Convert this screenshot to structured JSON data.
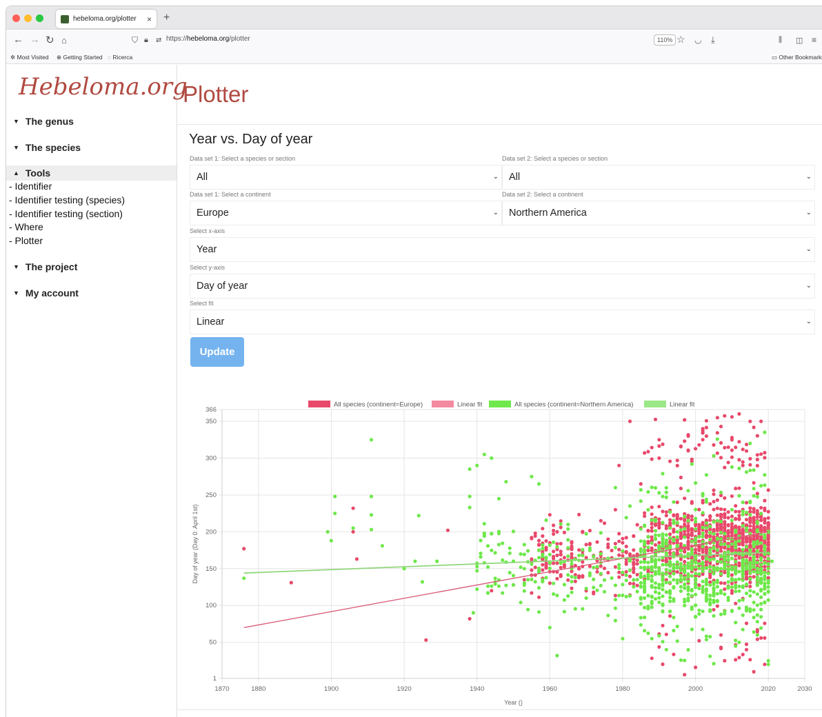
{
  "browser": {
    "tab_title": "hebeloma.org/plotter",
    "url_prefix": "https://",
    "url_host": "hebeloma.org",
    "url_path": "/plotter",
    "zoom": "110%",
    "bookmarks": [
      "Most Visited",
      "Getting Started",
      "Ricerca"
    ],
    "other_bookmarks": "Other Bookmarks"
  },
  "sidebar": {
    "logo": "Hebeloma.org",
    "sections": [
      {
        "label": "The genus"
      },
      {
        "label": "The species"
      },
      {
        "label": "Tools"
      },
      {
        "label": "The project"
      },
      {
        "label": "My account"
      }
    ],
    "tools_items": [
      "- Identifier",
      "- Identifier testing (species)",
      "- Identifier testing (section)",
      "- Where",
      "- Plotter"
    ]
  },
  "main": {
    "page_title": "Plotter",
    "chart_title": "Year vs. Day of year",
    "ds1_species_label": "Data set 1: Select a species or section",
    "ds1_species_value": "All",
    "ds2_species_label": "Data set 2: Select a species or section",
    "ds2_species_value": "All",
    "ds1_continent_label": "Data set 1: Select a continent",
    "ds1_continent_value": "Europe",
    "ds2_continent_label": "Data set 2: Select a continent",
    "ds2_continent_value": "Northern America",
    "xaxis_label": "Select x-axis",
    "xaxis_value": "Year",
    "yaxis_label": "Select y-axis",
    "yaxis_value": "Day of year",
    "fit_label": "Select fit",
    "fit_value": "Linear",
    "update_button": "Update"
  },
  "chart_data": {
    "type": "scatter",
    "xlabel": "Year ()",
    "ylabel": "Day of year (Day 0: April 1st)",
    "xlim": [
      1870,
      2030
    ],
    "ylim": [
      1,
      366
    ],
    "xticks": [
      1870,
      1880,
      1900,
      1920,
      1940,
      1960,
      1980,
      2000,
      2020,
      2030
    ],
    "yticks": [
      1,
      50,
      100,
      150,
      200,
      250,
      300,
      350,
      366
    ],
    "grid": true,
    "legend_position": "top",
    "colors": {
      "europe": "#e8496b",
      "europe_fit": "#f48aa0",
      "na": "#6ee84a",
      "na_fit": "#9be888"
    },
    "legend": [
      "All species (continent=Europe)",
      "Linear fit",
      "All species (continent=Northern America)",
      "Linear fit"
    ],
    "series": [
      {
        "name": "All species (continent=Europe)",
        "type": "scatter",
        "note": "approx 1500 points, dense 1980-2020",
        "points": [
          [
            1876,
            177
          ],
          [
            1889,
            131
          ],
          [
            1906,
            232
          ],
          [
            1906,
            200
          ],
          [
            1907,
            163
          ],
          [
            1932,
            202
          ],
          [
            1926,
            53
          ],
          [
            1938,
            82
          ],
          [
            1944,
            120
          ],
          [
            1950,
            128
          ],
          [
            1953,
            135
          ],
          [
            1958,
            148
          ],
          [
            1962,
            200
          ],
          [
            1964,
            165
          ],
          [
            1966,
            185
          ],
          [
            1968,
            140
          ],
          [
            1970,
            165
          ],
          [
            1972,
            118
          ],
          [
            1974,
            215
          ],
          [
            1976,
            190
          ],
          [
            1978,
            230
          ],
          [
            1979,
            290
          ],
          [
            1982,
            350
          ],
          [
            1985,
            265
          ],
          [
            1988,
            140
          ],
          [
            1990,
            300
          ],
          [
            1992,
            160
          ],
          [
            1995,
            240
          ],
          [
            1997,
            352
          ],
          [
            1998,
            310
          ],
          [
            2001,
            318
          ],
          [
            2003,
            330
          ],
          [
            2005,
            180
          ],
          [
            2006,
            355
          ],
          [
            2007,
            60
          ],
          [
            2008,
            25
          ],
          [
            2010,
            120
          ],
          [
            2012,
            360
          ],
          [
            2014,
            40
          ],
          [
            2016,
            10
          ],
          [
            2018,
            350
          ],
          [
            2019,
            20
          ]
        ]
      },
      {
        "name": "Linear fit",
        "type": "line",
        "points": [
          [
            1876,
            70
          ],
          [
            2020,
            200
          ]
        ]
      },
      {
        "name": "All species (continent=Northern America)",
        "type": "scatter",
        "note": "approx 1200 points",
        "points": [
          [
            1876,
            137
          ],
          [
            1899,
            200
          ],
          [
            1900,
            188
          ],
          [
            1901,
            248
          ],
          [
            1901,
            225
          ],
          [
            1906,
            205
          ],
          [
            1911,
            325
          ],
          [
            1911,
            248
          ],
          [
            1911,
            223
          ],
          [
            1911,
            203
          ],
          [
            1914,
            181
          ],
          [
            1920,
            150
          ],
          [
            1923,
            160
          ],
          [
            1924,
            222
          ],
          [
            1925,
            132
          ],
          [
            1929,
            160
          ],
          [
            1938,
            248
          ],
          [
            1938,
            233
          ],
          [
            1938,
            285
          ],
          [
            1939,
            90
          ],
          [
            1940,
            290
          ],
          [
            1942,
            305
          ],
          [
            1944,
            300
          ],
          [
            1946,
            245
          ],
          [
            1948,
            268
          ],
          [
            1950,
            160
          ],
          [
            1955,
            275
          ],
          [
            1957,
            265
          ],
          [
            1960,
            70
          ],
          [
            1962,
            32
          ],
          [
            1965,
            210
          ],
          [
            1970,
            110
          ],
          [
            1978,
            260
          ],
          [
            1980,
            55
          ],
          [
            1982,
            235
          ],
          [
            1988,
            55
          ],
          [
            1992,
            40
          ],
          [
            1995,
            200
          ],
          [
            2000,
            100
          ],
          [
            2005,
            150
          ],
          [
            2010,
            230
          ],
          [
            2013,
            160
          ],
          [
            2015,
            320
          ],
          [
            2017,
            60
          ],
          [
            2019,
            335
          ],
          [
            2020,
            20
          ],
          [
            2021,
            160
          ]
        ]
      },
      {
        "name": "Linear fit",
        "type": "line",
        "points": [
          [
            1876,
            144
          ],
          [
            2020,
            172
          ]
        ]
      }
    ]
  }
}
